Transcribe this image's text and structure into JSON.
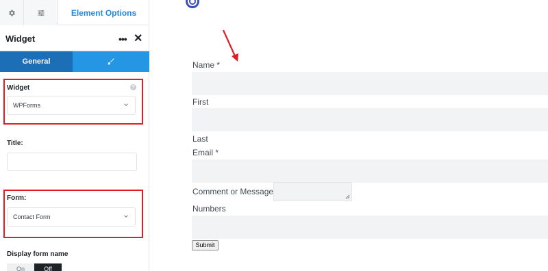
{
  "sidebar": {
    "tabs": {
      "settings_icon": "gear-icon",
      "sliders_icon": "sliders-icon",
      "element_options_label": "Element Options"
    },
    "header": {
      "title": "Widget"
    },
    "section_tabs": {
      "general_label": "General",
      "style_icon": "brush-icon"
    },
    "widget_field": {
      "label": "Widget",
      "value": "WPForms"
    },
    "title_field": {
      "label": "Title:",
      "value": ""
    },
    "form_field": {
      "label": "Form:",
      "value": "Contact Form"
    },
    "display_form_name": {
      "label": "Display form name",
      "on_label": "On",
      "off_label": "Off",
      "selected": "Off"
    }
  },
  "form": {
    "name_label": "Name *",
    "first_label": "First",
    "last_label": "Last",
    "email_label": "Email *",
    "comment_label": "Comment or Message *",
    "numbers_label": "Numbers",
    "submit_label": "Submit"
  },
  "colors": {
    "accent": "#1e88e5",
    "tab_active": "#1c6fb6",
    "tab_inactive": "#2496e3",
    "highlight": "#e31b23",
    "annotation_arrow": "#e31b23"
  }
}
